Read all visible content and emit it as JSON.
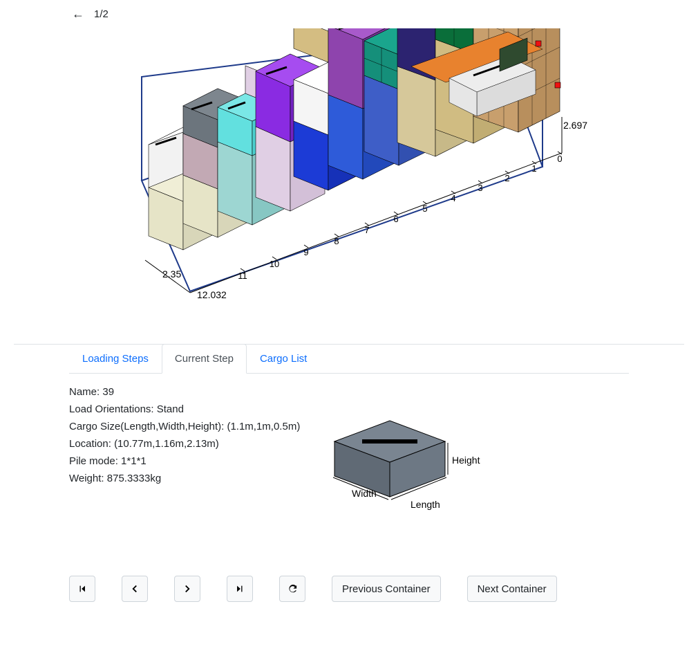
{
  "header": {
    "page_indicator": "1/2"
  },
  "container3d": {
    "length": 12.032,
    "width": 2.35,
    "height": 2.697,
    "x_ticks": [
      0,
      1,
      2,
      3,
      4,
      5,
      6,
      7,
      8,
      9,
      10,
      11
    ],
    "length_label": "12.032",
    "width_label": "2.35",
    "height_label": "2.697"
  },
  "tabs": {
    "loading_steps": "Loading Steps",
    "current_step": "Current Step",
    "cargo_list": "Cargo List"
  },
  "current_step": {
    "name_label": "Name:",
    "name_value": "39",
    "orient_label": "Load Orientations:",
    "orient_value": "Stand",
    "size_label": "Cargo Size(Length,Width,Height):",
    "size_value": "(1.1m,1m,0.5m)",
    "loc_label": "Location:",
    "loc_value": "(10.77m,1.16m,2.13m)",
    "pile_label": "Pile mode:",
    "pile_value": "1*1*1",
    "weight_label": "Weight:",
    "weight_value": "875.3333kg",
    "diagram_labels": {
      "length": "Length",
      "width": "Width",
      "height": "Height"
    }
  },
  "nav": {
    "prev_container": "Previous Container",
    "next_container": "Next Container"
  }
}
